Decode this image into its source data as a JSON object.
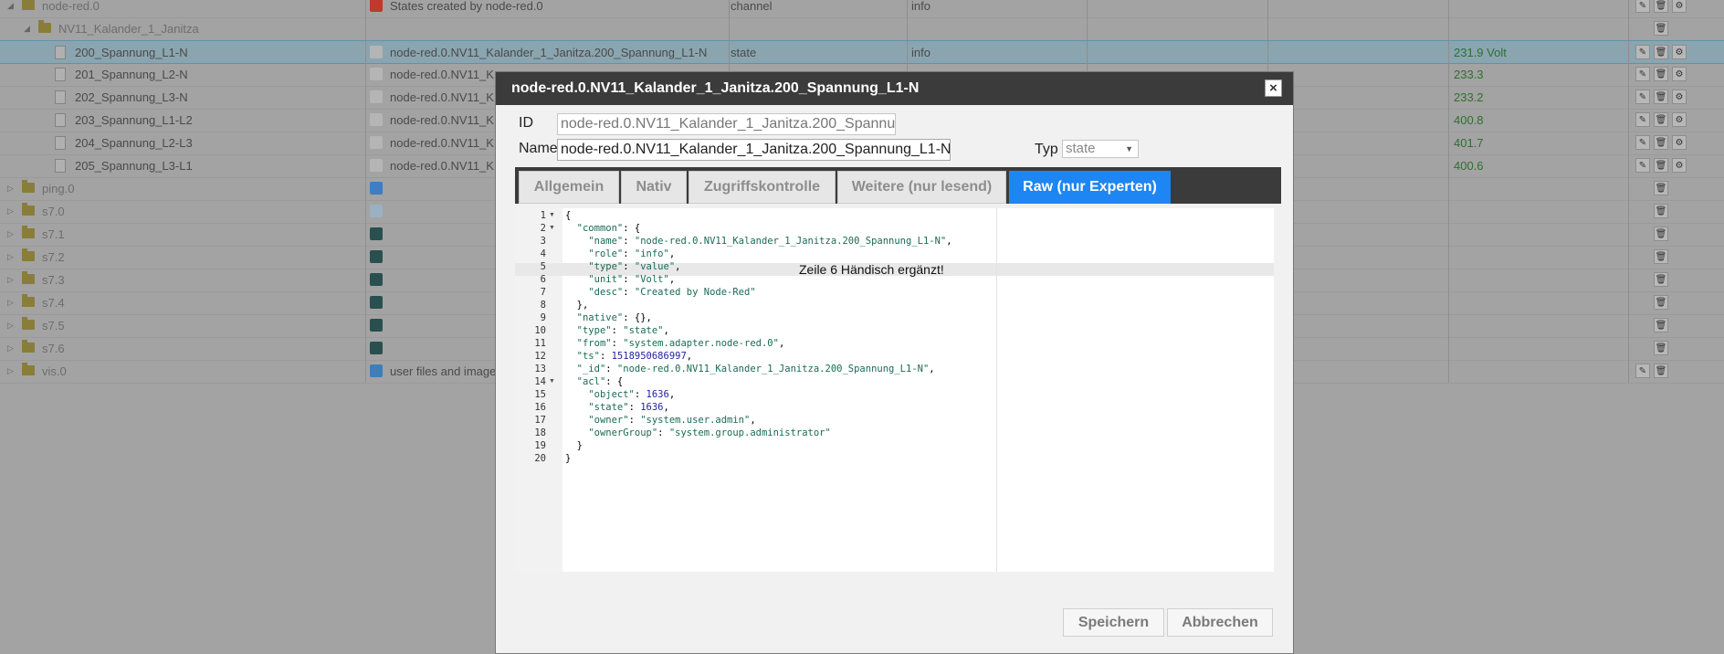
{
  "tree": {
    "rows": [
      {
        "name": "node-red.0",
        "desc": "States created by node-red.0",
        "type": "channel",
        "role": "info",
        "value": ""
      },
      {
        "name": "NV11_Kalander_1_Janitza",
        "desc": "",
        "type": "",
        "role": "",
        "value": ""
      },
      {
        "name": "200_Spannung_L1-N",
        "desc": "node-red.0.NV11_Kalander_1_Janitza.200_Spannung_L1-N",
        "type": "state",
        "role": "info",
        "value": "231.9 Volt"
      },
      {
        "name": "201_Spannung_L2-N",
        "desc": "node-red.0.NV11_K",
        "type": "",
        "role": "",
        "value": "233.3"
      },
      {
        "name": "202_Spannung_L3-N",
        "desc": "node-red.0.NV11_K",
        "type": "",
        "role": "",
        "value": "233.2"
      },
      {
        "name": "203_Spannung_L1-L2",
        "desc": "node-red.0.NV11_K",
        "type": "",
        "role": "",
        "value": "400.8"
      },
      {
        "name": "204_Spannung_L2-L3",
        "desc": "node-red.0.NV11_K",
        "type": "",
        "role": "",
        "value": "401.7"
      },
      {
        "name": "205_Spannung_L3-L1",
        "desc": "node-red.0.NV11_K",
        "type": "",
        "role": "",
        "value": "400.6"
      },
      {
        "name": "ping.0",
        "desc": "",
        "type": "",
        "role": "",
        "value": ""
      },
      {
        "name": "s7.0",
        "desc": "",
        "type": "",
        "role": "",
        "value": ""
      },
      {
        "name": "s7.1",
        "desc": "",
        "type": "",
        "role": "",
        "value": ""
      },
      {
        "name": "s7.2",
        "desc": "",
        "type": "",
        "role": "",
        "value": ""
      },
      {
        "name": "s7.3",
        "desc": "",
        "type": "",
        "role": "",
        "value": ""
      },
      {
        "name": "s7.4",
        "desc": "",
        "type": "",
        "role": "",
        "value": ""
      },
      {
        "name": "s7.5",
        "desc": "",
        "type": "",
        "role": "",
        "value": ""
      },
      {
        "name": "s7.6",
        "desc": "",
        "type": "",
        "role": "",
        "value": ""
      },
      {
        "name": "vis.0",
        "desc": "user files and image",
        "type": "",
        "role": "",
        "value": ""
      }
    ]
  },
  "dialog": {
    "title": "node-red.0.NV11_Kalander_1_Janitza.200_Spannung_L1-N",
    "close_glyph": "×",
    "id_label": "ID",
    "id_value": "node-red.0.NV11_Kalander_1_Janitza.200_Spannung_L1-N",
    "name_label": "Name",
    "name_value": "node-red.0.NV11_Kalander_1_Janitza.200_Spannung_L1-N",
    "typ_label": "Typ",
    "typ_value": "state",
    "tabs": [
      "Allgemein",
      "Nativ",
      "Zugriffskontrolle",
      "Weitere (nur lesend)",
      "Raw (nur Experten)"
    ],
    "active_tab": 4,
    "annotation": "Zeile 6 Händisch ergänzt!",
    "save_label": "Speichern",
    "cancel_label": "Abbrechen"
  },
  "code_lines": [
    "{",
    "  \"common\": {",
    "    \"name\": \"node-red.0.NV11_Kalander_1_Janitza.200_Spannung_L1-N\",",
    "    \"role\": \"info\",",
    "    \"type\": \"value\",",
    "    \"unit\": \"Volt\",",
    "    \"desc\": \"Created by Node-Red\"",
    "  },",
    "  \"native\": {},",
    "  \"type\": \"state\",",
    "  \"from\": \"system.adapter.node-red.0\",",
    "  \"ts\": 1518950686997,",
    "  \"_id\": \"node-red.0.NV11_Kalander_1_Janitza.200_Spannung_L1-N\",",
    "  \"acl\": {",
    "    \"object\": 1636,",
    "    \"state\": 1636,",
    "    \"owner\": \"system.user.admin\",",
    "    \"ownerGroup\": \"system.group.administrator\"",
    "  }",
    "}"
  ],
  "colors": {
    "accent": "#1d86f2",
    "title_bar": "#3b3b3b",
    "value_green": "#2f6f2f"
  }
}
